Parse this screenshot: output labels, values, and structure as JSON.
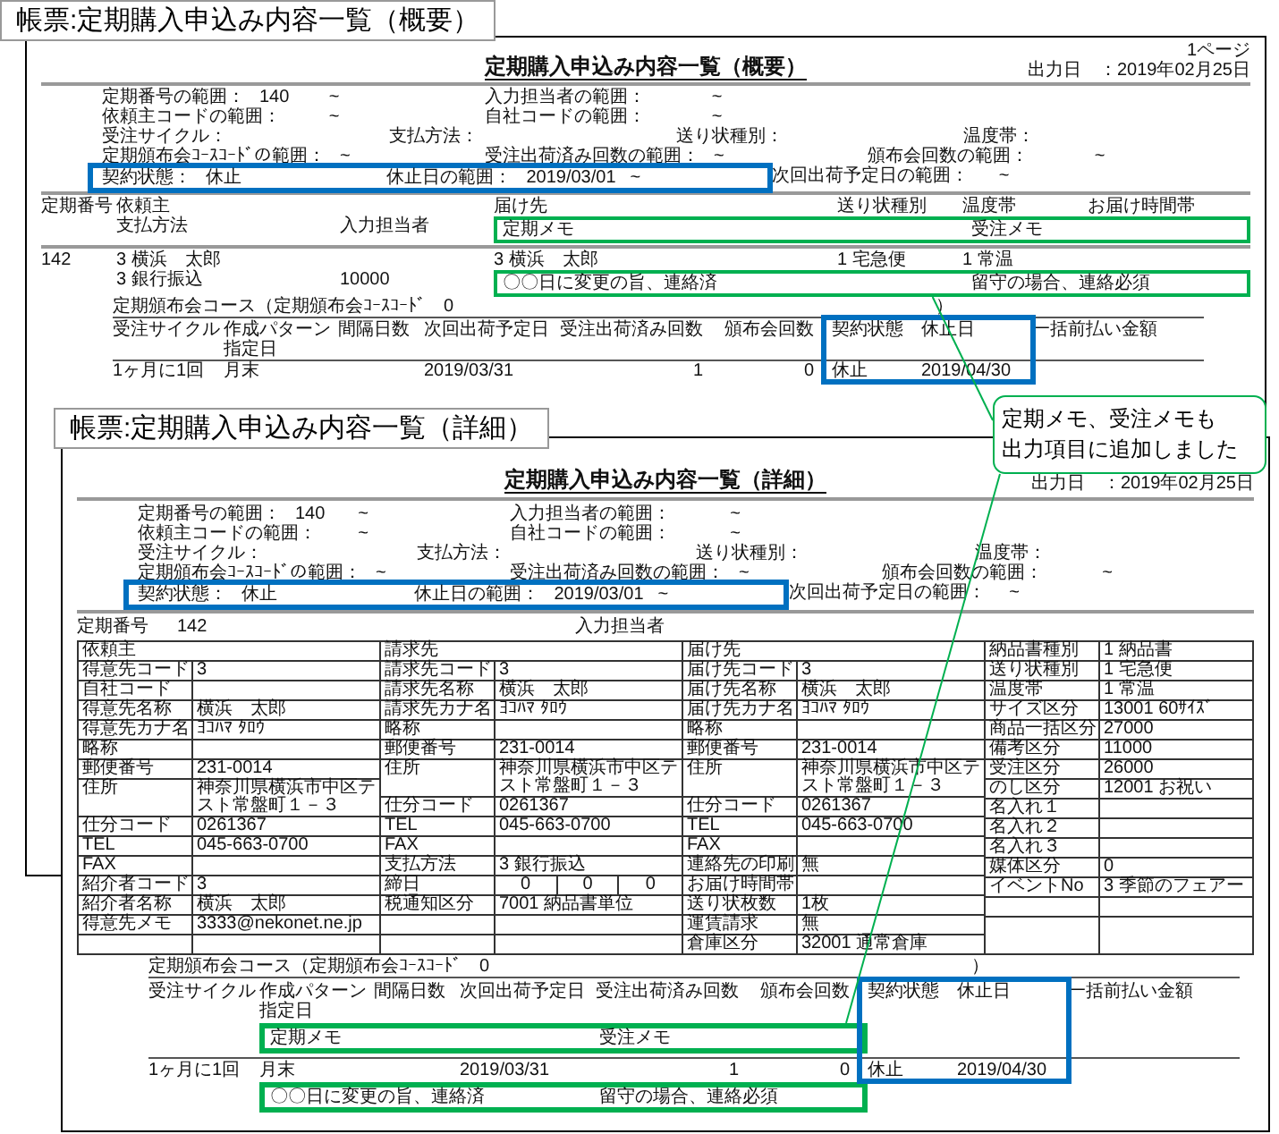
{
  "summary_label": "帳票:定期購入申込み内容一覧（概要）",
  "summary_report": {
    "title": "定期購入申込み内容一覧（概要）",
    "page": "1ページ",
    "output_date": "出力日　：2019年02月25日",
    "criteria": [
      [
        {
          "label": "定期番号の範囲：",
          "value": "140",
          "to": "~"
        },
        {
          "label": "入力担当者の範囲：",
          "to": "~"
        }
      ],
      [
        {
          "label": "依頼主コードの範囲：",
          "to": "~"
        },
        {
          "label": "自社コードの範囲：",
          "to": "~"
        }
      ],
      [
        {
          "label": "受注サイクル："
        },
        {
          "label": "支払方法："
        },
        {
          "label": "送り状種別："
        },
        {
          "label": "温度帯："
        }
      ],
      [
        {
          "label": "定期頒布会ｺｰｽｺｰﾄﾞの範囲：",
          "to": "~"
        },
        {
          "label": "受注出荷済み回数の範囲：",
          "to": "~"
        },
        {
          "label": "頒布会回数の範囲：",
          "to": "~"
        }
      ],
      [
        {
          "label": "契約状態：",
          "value": "休止",
          "boxed": true
        },
        {
          "label": "休止日の範囲：",
          "value": "2019/03/01",
          "to": "~",
          "boxed": true
        },
        {
          "label": "次回出荷予定日の範囲：",
          "to": "~"
        }
      ]
    ],
    "list_header": {
      "number": "定期番号",
      "client": "依頼主",
      "destination": "届け先",
      "slip_type": "送り状種別",
      "temperature": "温度帯",
      "delivery_time": "お届け時間帯",
      "payment": "支払方法",
      "staff": "入力担当者",
      "contract_memo": "定期メモ",
      "order_memo": "受注メモ"
    },
    "list_rows": [
      {
        "number": "142",
        "client": "3 横浜　太郎",
        "destination": "3 横浜　太郎",
        "slip_type": "1 宅急便",
        "temperature": "1 常温",
        "payment": "3 銀行振込",
        "staff": "10000",
        "contract_memo": "〇〇日に変更の旨、連絡済",
        "order_memo": "留守の場合、連絡必須"
      }
    ],
    "course": {
      "title": "定期頒布会コース（定期頒布会ｺｰｽｺｰﾄﾞ　0",
      "close": "）",
      "columns": [
        {
          "label": "受注サイクル",
          "value": "1ヶ月に1回"
        },
        {
          "label": "作成パターン",
          "sub": "指定日",
          "value": "月末"
        },
        {
          "label": "間隔日数"
        },
        {
          "label": "次回出荷予定日",
          "value": "2019/03/31"
        },
        {
          "label": "受注出荷済み回数",
          "value": "1",
          "kind": "number"
        },
        {
          "label": "頒布会回数",
          "value": "0",
          "kind": "number"
        },
        {
          "label": "契約状態",
          "boxed": true,
          "value": "休止"
        },
        {
          "label": "休止日",
          "boxed": true,
          "value": "2019/04/30"
        },
        {
          "label": "一括前払い金額"
        }
      ]
    }
  },
  "detail_label": "帳票:定期購入申込み内容一覧（詳細）",
  "detail_report": {
    "title": "定期購入申込み内容一覧（詳細）",
    "output_date": "出力日　：2019年02月25日",
    "criteria": [
      [
        {
          "label": "定期番号の範囲：",
          "value": "140",
          "to": "~"
        },
        {
          "label": "入力担当者の範囲：",
          "to": "~"
        }
      ],
      [
        {
          "label": "依頼主コードの範囲：",
          "to": "~"
        },
        {
          "label": "自社コードの範囲：",
          "to": "~"
        }
      ],
      [
        {
          "label": "受注サイクル："
        },
        {
          "label": "支払方法："
        },
        {
          "label": "送り状種別："
        },
        {
          "label": "温度帯："
        }
      ],
      [
        {
          "label": "定期頒布会ｺｰｽｺｰﾄﾞの範囲：",
          "to": "~"
        },
        {
          "label": "受注出荷済み回数の範囲：",
          "to": "~"
        },
        {
          "label": "頒布会回数の範囲：",
          "to": "~"
        }
      ],
      [
        {
          "label": "契約状態：",
          "value": "休止",
          "boxed": true
        },
        {
          "label": "休止日の範囲：",
          "value": "2019/03/01",
          "to": "~",
          "boxed": true
        },
        {
          "label": "次回出荷予定日の範囲：",
          "to": "~"
        }
      ]
    ],
    "detail_header": {
      "number_label": "定期番号",
      "number": "142",
      "staff_label": "入力担当者"
    },
    "detail_groups": [
      {
        "title": "依頼主",
        "fields": [
          {
            "label": "得意先コード",
            "value": "3"
          },
          {
            "label": "自社コード"
          },
          {
            "label": "得意先名称",
            "value": "横浜　太郎"
          },
          {
            "label": "得意先カナ名",
            "value": "ﾖｺﾊﾏ ﾀﾛｳ"
          },
          {
            "label": "略称"
          },
          {
            "label": "郵便番号",
            "value": "231-0014"
          },
          {
            "label": "住所",
            "value": "神奈川県横浜市中区テスト常盤町１－３"
          },
          {
            "label": "仕分コード",
            "value": "0261367"
          },
          {
            "label": "TEL",
            "value": "045-663-0700"
          },
          {
            "label": "FAX"
          },
          {
            "label": "紹介者コード",
            "value": "3"
          },
          {
            "label": "紹介者名称",
            "value": "横浜　太郎"
          },
          {
            "label": "得意先メモ",
            "value": "3333@nekonet.ne.jp"
          }
        ]
      },
      {
        "title": "請求先",
        "fields": [
          {
            "label": "請求先コード",
            "value": "3"
          },
          {
            "label": "請求先名称",
            "value": "横浜　太郎"
          },
          {
            "label": "請求先カナ名",
            "value": "ﾖｺﾊﾏ ﾀﾛｳ"
          },
          {
            "label": "略称"
          },
          {
            "label": "郵便番号",
            "value": "231-0014"
          },
          {
            "label": "住所",
            "value": "神奈川県横浜市中区テスト常盤町１－３"
          },
          {
            "label": "仕分コード",
            "value": "0261367"
          },
          {
            "label": "TEL",
            "value": "045-663-0700"
          },
          {
            "label": "FAX"
          },
          {
            "label": "支払方法",
            "value": "3 銀行振込"
          },
          {
            "label": "締日",
            "value": [
              "0",
              "0",
              "0"
            ]
          },
          {
            "label": "税通知区分",
            "value": "7001 納品書単位"
          }
        ]
      },
      {
        "title": "届け先",
        "fields": [
          {
            "label": "届け先コード",
            "value": "3"
          },
          {
            "label": "届け先名称",
            "value": "横浜　太郎"
          },
          {
            "label": "届け先カナ名",
            "value": "ﾖｺﾊﾏ ﾀﾛｳ"
          },
          {
            "label": "略称"
          },
          {
            "label": "郵便番号",
            "value": "231-0014"
          },
          {
            "label": "住所",
            "value": "神奈川県横浜市中区テスト常盤町１－３"
          },
          {
            "label": "仕分コード",
            "value": "0261367"
          },
          {
            "label": "TEL",
            "value": "045-663-0700"
          },
          {
            "label": "FAX"
          },
          {
            "label": "連絡先の印刷",
            "value": "無"
          },
          {
            "label": "お届け時間帯"
          },
          {
            "label": "送り状枚数",
            "value": "1枚"
          },
          {
            "label": "運賃請求",
            "value": "無"
          },
          {
            "label": "倉庫区分",
            "value": "32001 通常倉庫"
          }
        ]
      },
      {
        "fields": [
          {
            "label": "納品書種別",
            "value": "1 納品書"
          },
          {
            "label": "送り状種別",
            "value": "1 宅急便"
          },
          {
            "label": "温度帯",
            "value": "1 常温"
          },
          {
            "label": "サイズ区分",
            "value": "13001 60ｻｲｽﾞ"
          },
          {
            "label": "商品一括区分",
            "value": "27000"
          },
          {
            "label": "備考区分",
            "value": "11000"
          },
          {
            "label": "受注区分",
            "value": "26000"
          },
          {
            "label": "のし区分",
            "value": "12001 お祝い"
          },
          {
            "label": "名入れ１"
          },
          {
            "label": "名入れ２"
          },
          {
            "label": "名入れ３"
          },
          {
            "label": "媒体区分",
            "value": "0"
          },
          {
            "label": "イベントNo",
            "value": "3 季節のフェアー"
          }
        ]
      }
    ],
    "course": {
      "title": "定期頒布会コース（定期頒布会ｺｰｽｺｰﾄﾞ　0",
      "close": "）",
      "columns": [
        {
          "label": "受注サイクル",
          "value": "1ヶ月に1回"
        },
        {
          "label": "作成パターン",
          "sub": "指定日",
          "value": "月末"
        },
        {
          "label": "間隔日数"
        },
        {
          "label": "次回出荷予定日",
          "value": "2019/03/31"
        },
        {
          "label": "受注出荷済み回数",
          "value": "1",
          "kind": "number"
        },
        {
          "label": "頒布会回数",
          "value": "0",
          "kind": "number"
        },
        {
          "label": "契約状態",
          "boxed": true,
          "value": "休止"
        },
        {
          "label": "休止日",
          "boxed": true,
          "value": "2019/04/30"
        },
        {
          "label": "一括前払い金額"
        }
      ],
      "memo_header": {
        "contract_memo": "定期メモ",
        "order_memo": "受注メモ"
      },
      "row_memo": {
        "contract_memo": "〇〇日に変更の旨、連絡済",
        "order_memo": "留守の場合、連絡必須"
      }
    }
  },
  "callout": {
    "lines": [
      "定期メモ、受注メモも",
      "出力項目に追加しました"
    ]
  }
}
